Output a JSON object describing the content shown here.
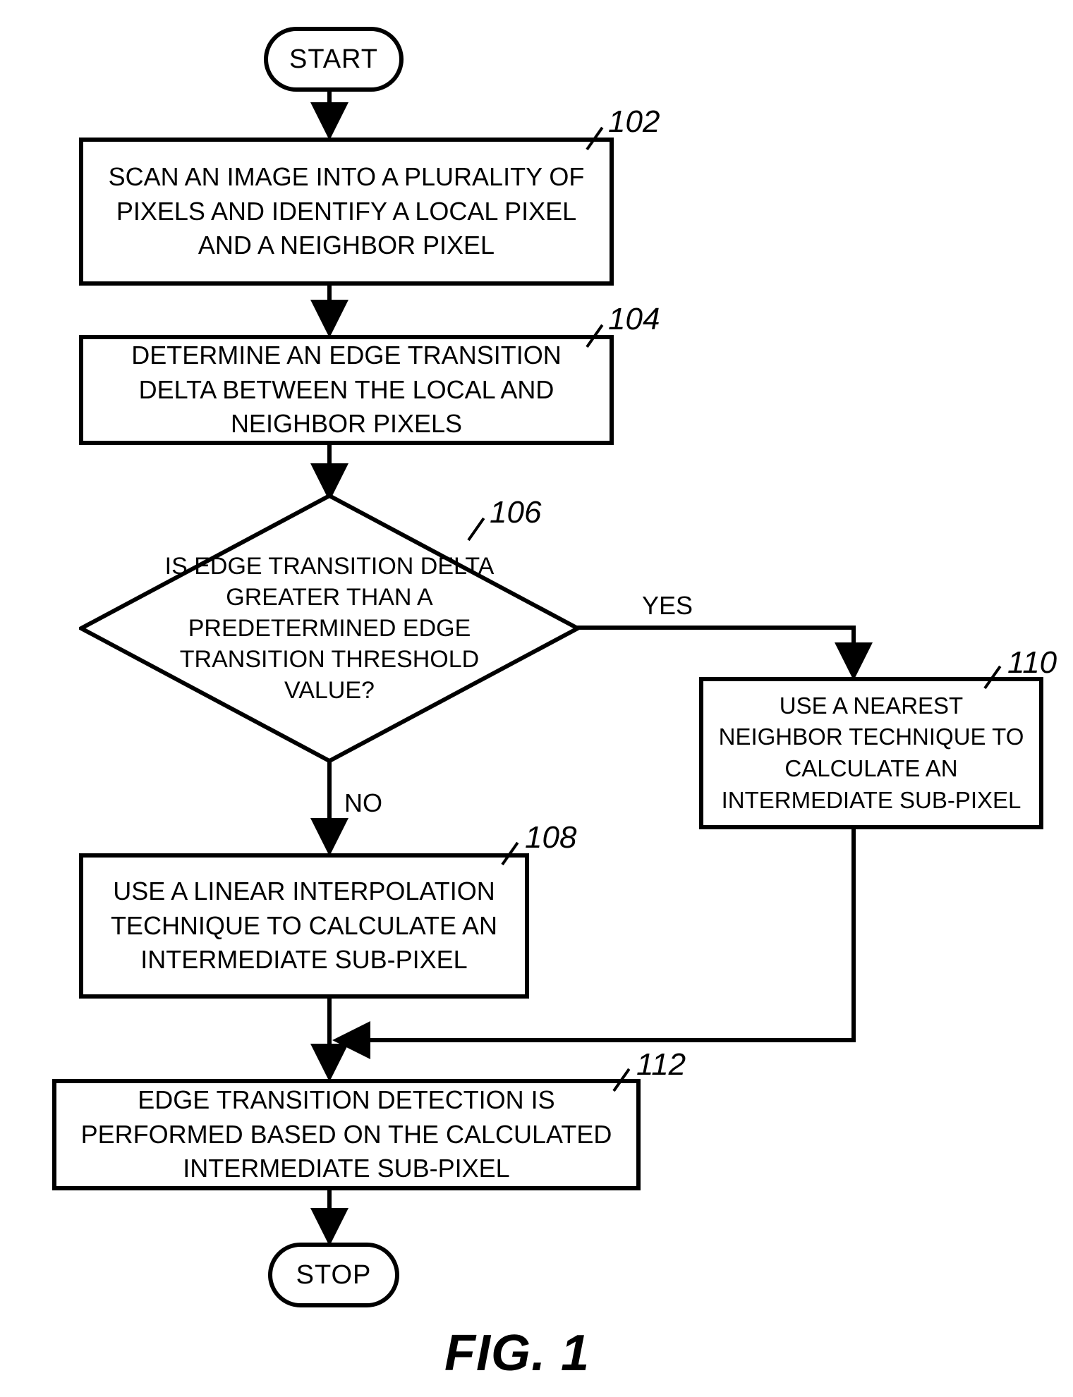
{
  "flow": {
    "start_label": "START",
    "stop_label": "STOP",
    "steps": {
      "s102": {
        "ref": "102",
        "text": "SCAN AN IMAGE INTO A PLURALITY OF PIXELS AND IDENTIFY A LOCAL PIXEL AND A NEIGHBOR PIXEL"
      },
      "s104": {
        "ref": "104",
        "text": "DETERMINE AN EDGE TRANSITION DELTA BETWEEN THE LOCAL AND NEIGHBOR PIXELS"
      },
      "s106": {
        "ref": "106",
        "text": "IS EDGE TRANSITION DELTA GREATER THAN A PREDETERMINED EDGE TRANSITION THRESHOLD VALUE?",
        "yes_label": "YES",
        "no_label": "NO"
      },
      "s108": {
        "ref": "108",
        "text": "USE A LINEAR INTERPOLATION TECHNIQUE TO CALCULATE AN INTERMEDIATE SUB-PIXEL"
      },
      "s110": {
        "ref": "110",
        "text": "USE A NEAREST NEIGHBOR TECHNIQUE TO CALCULATE AN INTERMEDIATE SUB-PIXEL"
      },
      "s112": {
        "ref": "112",
        "text": "EDGE TRANSITION DETECTION IS PERFORMED BASED ON THE CALCULATED INTERMEDIATE SUB-PIXEL"
      }
    }
  },
  "figure_label": "FIG. 1"
}
